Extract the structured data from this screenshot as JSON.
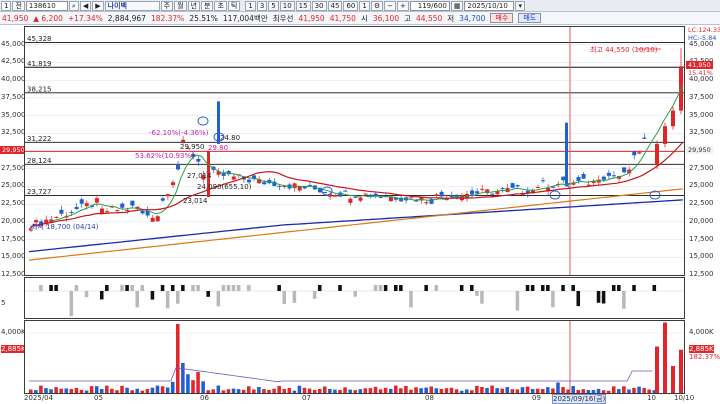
{
  "toolbar": {
    "tab_label": "1",
    "code": "138610",
    "stock_name": "나이벡",
    "period_buttons": [
      "주",
      "월",
      "년",
      "분",
      "초",
      "틱"
    ],
    "interval_buttons": [
      "1",
      "3",
      "5",
      "10",
      "15",
      "30",
      "45",
      "60",
      "1"
    ],
    "counter": "119/600",
    "date": "2025/10/10"
  },
  "quote": {
    "price": "41,950",
    "change": "▲ 6,200",
    "change_pct": "+17.34%",
    "volume": "2,884,967",
    "volume_ratio": "182.37%",
    "turnover_rate": "25.51%",
    "amount": "117,004백만",
    "order_type": "최우선",
    "ask": "41,950",
    "bid": "41,750",
    "open_label": "시",
    "open": "36,100",
    "high_label": "고",
    "high": "44,550",
    "low_label": "저",
    "low": "34,700",
    "buy_label": "매수",
    "sell_label": "매도"
  },
  "price_axis": {
    "left_ticks": [
      "45,000",
      "42,500",
      "40,000",
      "37,500",
      "35,000",
      "32,500",
      "30,000",
      "27,500",
      "25,000",
      "22,500",
      "20,000",
      "17,500",
      "15,000",
      "12,500"
    ],
    "right_ticks": [
      "45,000",
      "42,500",
      "40,000",
      "37,500",
      "35,000",
      "32,500",
      "30,000",
      "27,500",
      "25,000",
      "22,500",
      "20,000",
      "17,500",
      "15,000",
      "12,500"
    ],
    "h_levels": [
      "45,328",
      "41,819",
      "38,215",
      "31,222",
      "28,124",
      "23,727"
    ],
    "left_flag": "29,950",
    "right_flags": {
      "lc": "LC:124.33",
      "hc": "HC:-5.84",
      "price": "41,950",
      "pct": "15.41%",
      "mid": "29,950"
    }
  },
  "annotations": {
    "high_note": "최고 44,550 (10/10)",
    "low_note": "최저 18,700 (04/14)",
    "pct1": "-62.10%(-4.36%)",
    "pct2": "53.62%(10.93%)",
    "level_a": "29,950",
    "level_b": "27,014",
    "level_c": "24,090(655.10)",
    "level_d": "23,014",
    "level_e": "24.80",
    "level_f": "29.80"
  },
  "osc_axis": {
    "left_tick": "5"
  },
  "volume_axis": {
    "left_ticks": [
      "4,000K",
      "2,885K"
    ],
    "right_ticks": [
      "4,000K",
      "2,885K",
      "182.37%"
    ]
  },
  "x_axis": {
    "ticks": [
      "2025/04",
      "05",
      "06",
      "07",
      "08",
      "09",
      "2025/09/16(금)",
      "10",
      "10/10"
    ]
  },
  "colors": {
    "up": "#e0262b",
    "down": "#1f5fd0",
    "ma5": "#24a148",
    "ma20": "#c4161c",
    "ma60": "#1a2aa8",
    "ma120": "#d97a14",
    "bg": "#ffffff"
  }
}
